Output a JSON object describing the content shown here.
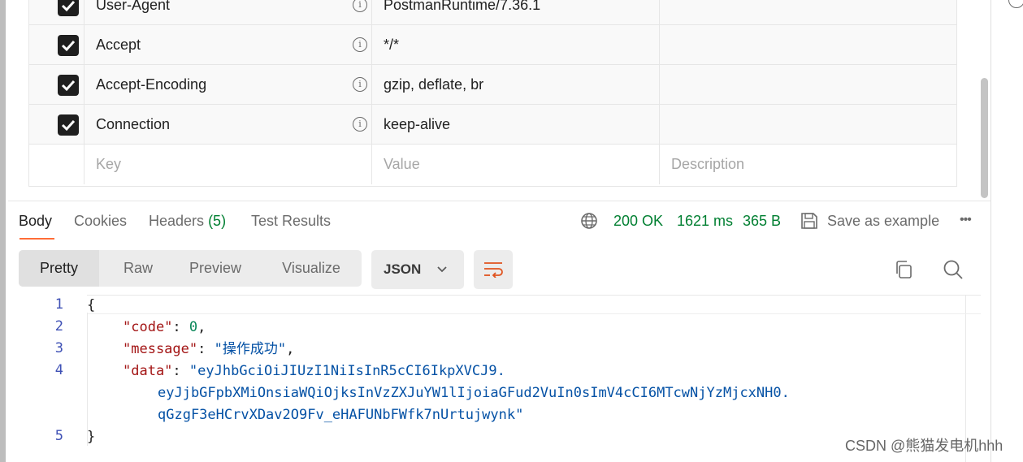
{
  "headers_table": {
    "rows": [
      {
        "key": "User-Agent",
        "value": "PostmanRuntime/7.36.1",
        "description": ""
      },
      {
        "key": "Accept",
        "value": "*/*",
        "description": ""
      },
      {
        "key": "Accept-Encoding",
        "value": "gzip, deflate, br",
        "description": ""
      },
      {
        "key": "Connection",
        "value": "keep-alive",
        "description": ""
      }
    ],
    "placeholders": {
      "key": "Key",
      "value": "Value",
      "description": "Description"
    },
    "info_glyph": "i"
  },
  "response": {
    "tabs": {
      "body": "Body",
      "cookies": "Cookies",
      "headers": "Headers",
      "headers_count": "(5)",
      "test_results": "Test Results"
    },
    "status": "200 OK",
    "time": "1621 ms",
    "size": "365 B",
    "save_example": "Save as example",
    "more": "•••",
    "view_modes": [
      "Pretty",
      "Raw",
      "Preview",
      "Visualize"
    ],
    "format": "JSON"
  },
  "code": {
    "line_numbers": [
      "1",
      "2",
      "3",
      "4",
      "5"
    ],
    "open_brace": "{",
    "close_brace": "}",
    "code_key": "\"code\"",
    "code_value": "0",
    "message_key": "\"message\"",
    "message_value": "\"操作成功\"",
    "data_key": "\"data\"",
    "data_value_line1": "\"eyJhbGciOiJIUzI1NiIsInR5cCI6IkpXVCJ9.",
    "data_value_line2": "eyJjbGFpbXMiOnsiaWQiOjksInVzZXJuYW1lIjoiaGFud2VuIn0sImV4cCI6MTcwNjYzMjcxNH0.",
    "data_value_line3": "qGzgF3eHCrvXDav2O9Fv_eHAFUNbFWfk7nUrtujwynk\"",
    "colon": ": ",
    "comma": ","
  },
  "watermark": "CSDN @熊猫发电机hhh",
  "icons": [
    "info-icon",
    "globe-icon",
    "save-icon",
    "chevron-down-icon",
    "wrap-icon",
    "copy-icon",
    "search-icon",
    "checkbox-checked-icon"
  ]
}
